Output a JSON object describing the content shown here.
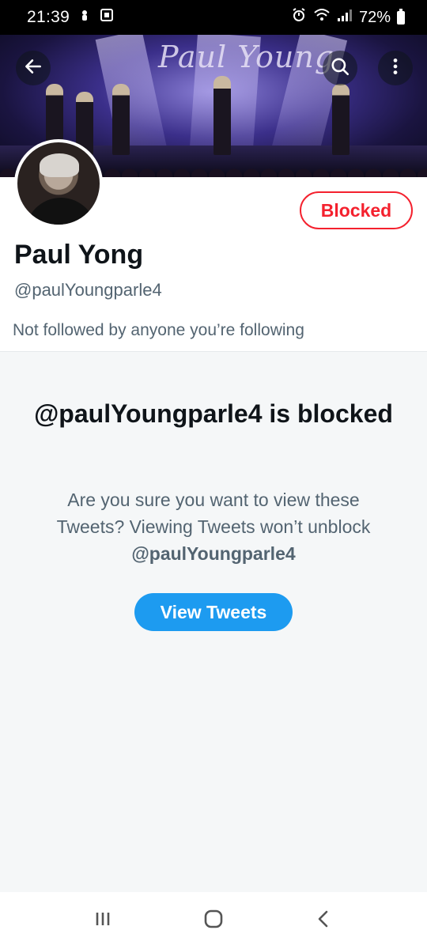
{
  "status_bar": {
    "time": "21:39",
    "battery": "72%",
    "left_icons": [
      "usb-debug-icon",
      "screenshot-icon"
    ],
    "right_icons": [
      "alarm-icon",
      "wifi-icon",
      "signal-icon",
      "battery-icon"
    ]
  },
  "header": {
    "banner_logo_text": "Paul Young",
    "back_icon": "arrow-left-icon",
    "search_icon": "search-icon",
    "more_icon": "more-vertical-icon"
  },
  "profile": {
    "display_name": "Paul Yong",
    "handle": "@paulYoungparle4",
    "blocked_label": "Blocked",
    "followers_note": "Not followed by anyone you’re following"
  },
  "blocked_notice": {
    "title": "@paulYoungparle4 is blocked",
    "desc_prefix": "Are you sure you want to view these Tweets? Viewing Tweets won’t unblock",
    "desc_handle": "@paulYoungparle4",
    "view_button": "View Tweets"
  },
  "nav_bar": {
    "recents_icon": "recent-apps-icon",
    "home_icon": "home-icon",
    "back_icon": "back-icon"
  },
  "colors": {
    "blocked_red": "#f4212e",
    "primary_blue": "#1d9bf0",
    "secondary_text": "#536471",
    "panel_bg": "#f5f7f8"
  }
}
